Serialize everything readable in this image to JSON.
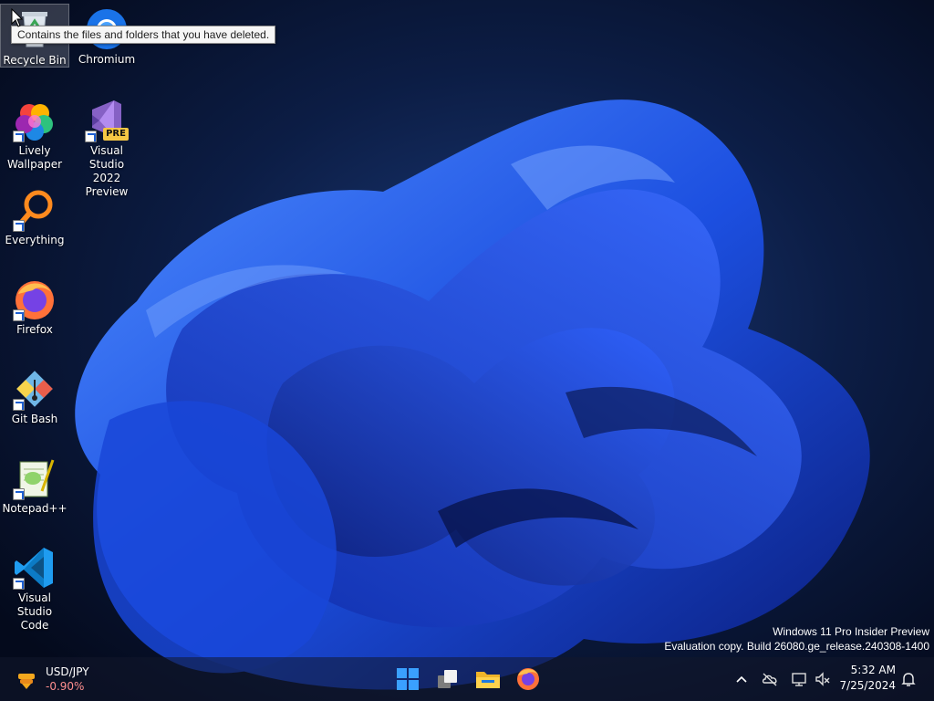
{
  "desktop": {
    "icons": [
      {
        "label": "Recycle Bin",
        "icon": "recycle-bin-icon"
      },
      {
        "label": "Chromium",
        "icon": "chromium-icon"
      },
      {
        "label": "Lively Wallpaper",
        "icon": "lively-wallpaper-icon"
      },
      {
        "label": "Visual Studio 2022 Preview",
        "icon": "visual-studio-preview-icon",
        "badge": "PRE"
      },
      {
        "label": "Everything",
        "icon": "everything-search-icon"
      },
      {
        "label": "Firefox",
        "icon": "firefox-icon"
      },
      {
        "label": "Git Bash",
        "icon": "git-bash-icon"
      },
      {
        "label": "Notepad++",
        "icon": "notepad-plus-plus-icon"
      },
      {
        "label": "Visual Studio Code",
        "icon": "vscode-icon"
      }
    ],
    "tooltip": "Contains the files and folders that you have deleted."
  },
  "watermark": {
    "line1": "Windows 11 Pro Insider Preview",
    "line2": "Evaluation copy. Build 26080.ge_release.240308-1400"
  },
  "taskbar": {
    "widget": {
      "title": "USD/JPY",
      "change": "-0.90%"
    },
    "apps": [
      "start-icon",
      "task-view-icon",
      "file-explorer-icon",
      "firefox-icon"
    ],
    "tray": [
      "chevron-up-icon",
      "onedrive-offline-icon",
      "network-icon",
      "volume-muted-icon"
    ],
    "clock": {
      "time": "5:32 AM",
      "date": "7/25/2024"
    },
    "notification_icon": "bell-icon"
  },
  "colors": {
    "accent": "#1e5bff",
    "widget_negative": "#ff8f8f"
  }
}
